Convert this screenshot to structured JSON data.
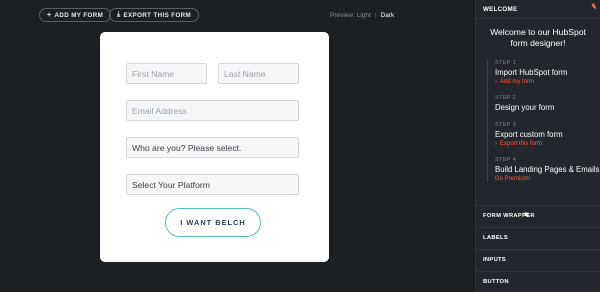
{
  "toolbar": {
    "add_form": {
      "icon": "plus-icon",
      "glyph": "+",
      "label": "ADD MY FORM"
    },
    "export_form": {
      "icon": "download-icon",
      "glyph": "⤓",
      "label": "EXPORT THIS FORM"
    }
  },
  "preview": {
    "label": "Preview: Light",
    "separator": "|",
    "dark": "Dark"
  },
  "form": {
    "first_name": {
      "placeholder": "First Name"
    },
    "last_name": {
      "placeholder": "Last Name"
    },
    "email": {
      "placeholder": "Email Address"
    },
    "role_select": {
      "value": "Who are you? Please select."
    },
    "platform_select": {
      "value": "Select Your Platform"
    },
    "submit_label": "I WANT BELCH"
  },
  "panel": {
    "header": "WELCOME",
    "edit_icon": "pencil-icon",
    "welcome_text": "Welcome to our HubSpot form designer!",
    "steps": [
      {
        "num": "STEP 1",
        "title": "Import HubSpot form",
        "link": "Add my form"
      },
      {
        "num": "STEP 2",
        "title": "Design your form"
      },
      {
        "num": "STEP 3",
        "title": "Export custom form",
        "link": "Export this form"
      },
      {
        "num": "STEP 4",
        "title": "Build Landing Pages & Emails",
        "link": "Go Premium!"
      }
    ],
    "sections": [
      "FORM WRAPPER",
      "LABELS",
      "INPUTS",
      "BUTTON"
    ]
  },
  "colors": {
    "accent": "#ff5a43",
    "button_border": "#54bfc4",
    "background": "#1c1f24",
    "panel": "#23272d"
  }
}
